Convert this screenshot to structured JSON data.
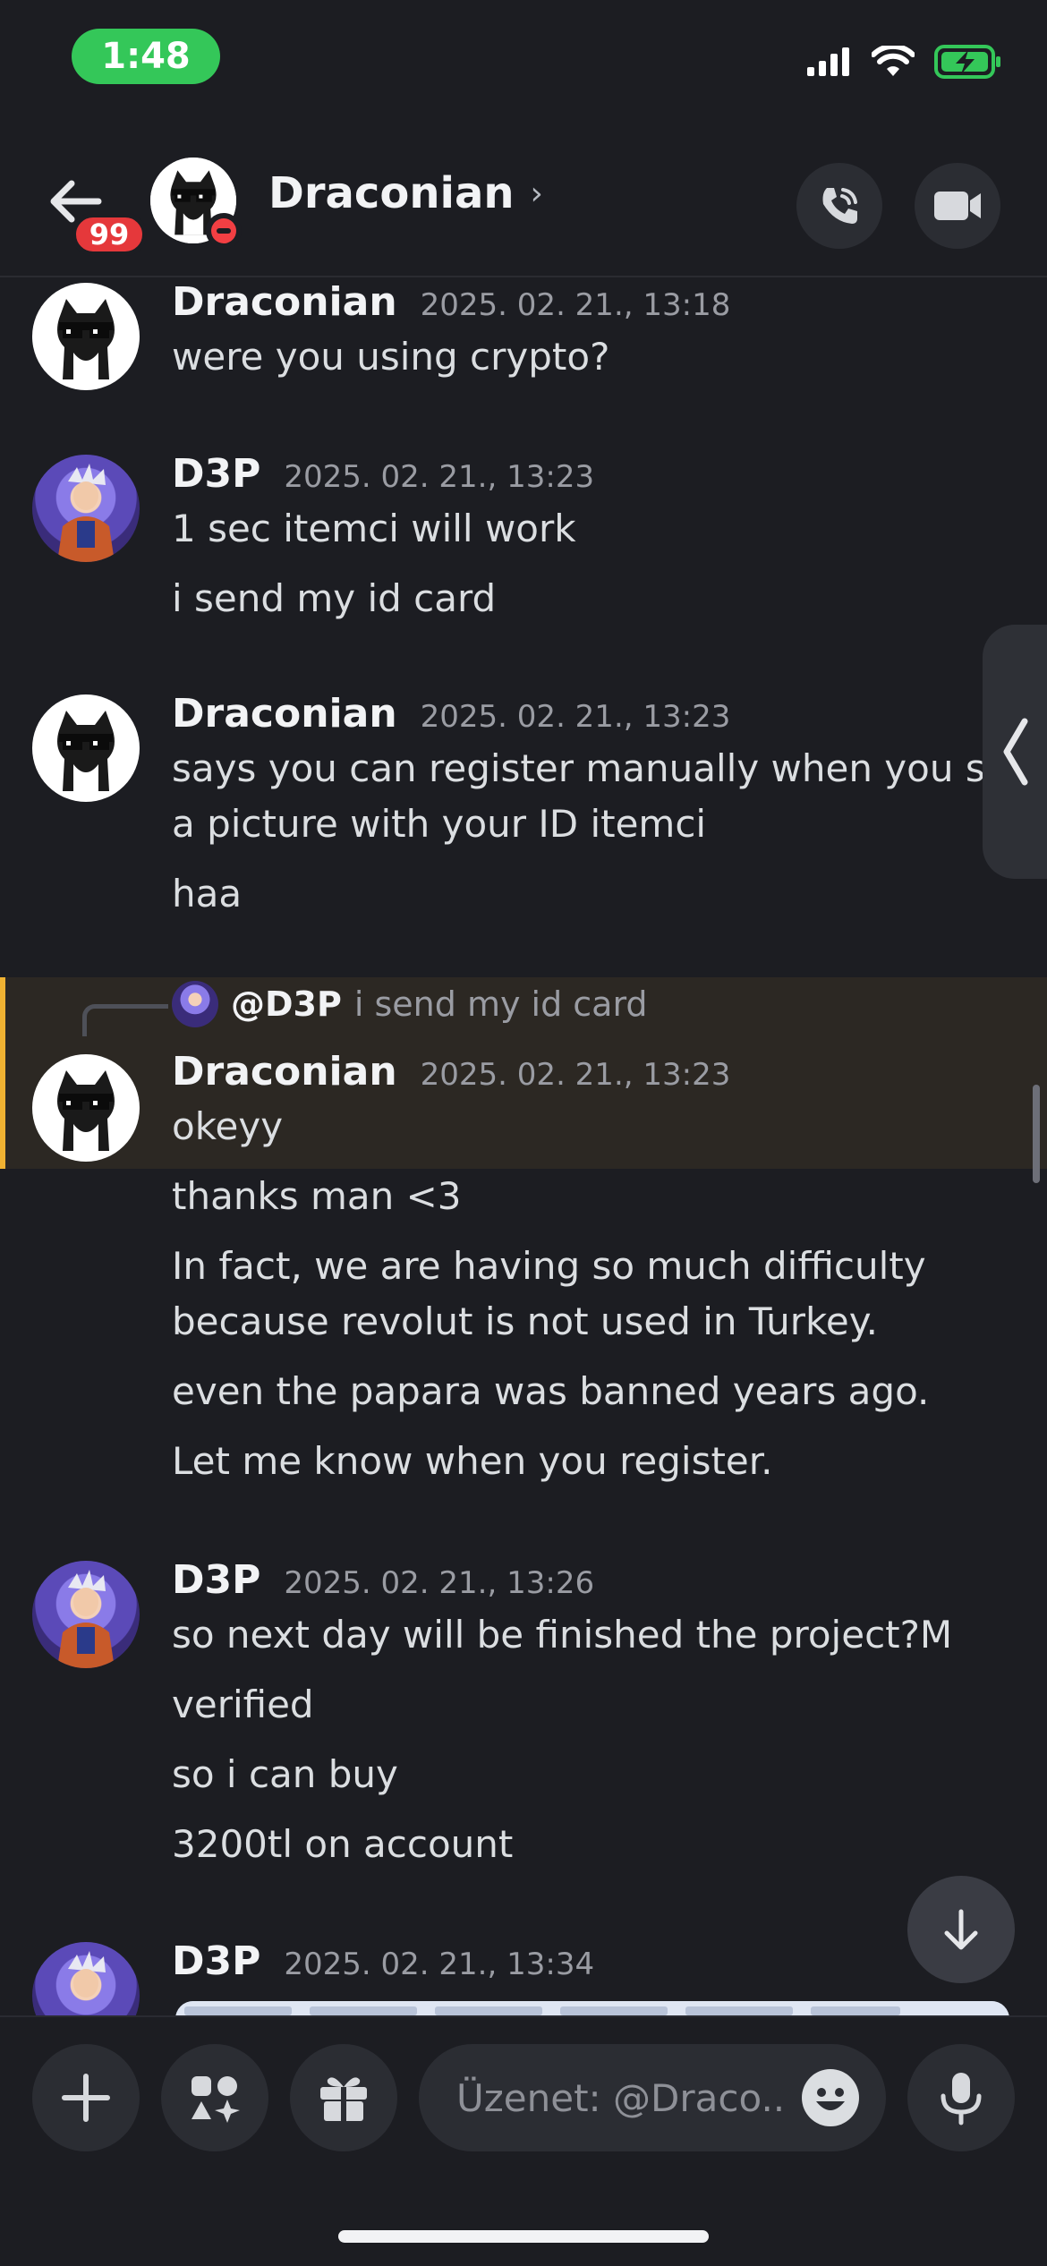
{
  "status": {
    "time": "1:48"
  },
  "header": {
    "title": "Draconian",
    "unread_badge": "99"
  },
  "colors": {
    "accent_highlight": "#f0b232",
    "background": "#1c1d22",
    "status_green": "#34c759",
    "dnd_red": "#f23f43"
  },
  "messages": [
    {
      "author": "Draconian",
      "time": "2025. 02. 21., 13:18",
      "lines": [
        "were you using crypto?"
      ]
    },
    {
      "author": "D3P",
      "time": "2025. 02. 21., 13:23",
      "lines": [
        "1 sec itemci will work",
        "i send my id card"
      ]
    },
    {
      "author": "Draconian",
      "time": "2025. 02. 21., 13:23",
      "lines": [
        "says you can register manually when you send",
        "a picture with your ID itemci",
        "haa"
      ]
    },
    {
      "author": "Draconian",
      "time": "2025. 02. 21., 13:23",
      "reply": {
        "user": "@D3P",
        "text": "i send my id card"
      },
      "lines": [
        "okeyy",
        "thanks man <3",
        "In fact, we are having so much difficulty",
        "because revolut is not used in Turkey.",
        "even the papara was banned years ago.",
        "Let me know when you register."
      ]
    },
    {
      "author": "D3P",
      "time": "2025. 02. 21., 13:26",
      "lines": [
        "so next day will be finished the project?M",
        "verified",
        "so i can buy",
        "3200tl on account"
      ]
    },
    {
      "author": "D3P",
      "time": "2025. 02. 21., 13:34",
      "lines": []
    }
  ],
  "composer": {
    "placeholder": "Üzenet: @Draco..."
  },
  "icons": {
    "back": "arrow-left-icon",
    "call": "phone-icon",
    "video": "video-camera-icon",
    "plus": "plus-icon",
    "apps": "apps-icon",
    "gift": "gift-icon",
    "emoji": "emoji-icon",
    "mic": "microphone-icon",
    "jump": "arrow-down-icon",
    "side_panel": "chevron-left-icon"
  }
}
